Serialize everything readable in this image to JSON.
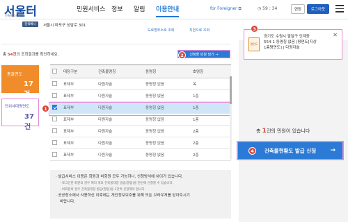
{
  "header": {
    "logo": "서울터",
    "logo_sub": "건축행정시스템",
    "nav": [
      "민원서비스",
      "정보",
      "알림",
      "이용안내"
    ],
    "foreigner_link": "for Foreigner",
    "timer": "59 : 34",
    "extend_label": "연장",
    "logout_label": "로그아웃"
  },
  "address": {
    "tag": "검색예시",
    "text": "서울시 마포구 성암로 301",
    "link1": "도로명주소로 조회",
    "link2": "지번으로 조회"
  },
  "summary": {
    "prefix": "총 ",
    "count": "54건",
    "suffix": "의 조회결과를 확인하세요."
  },
  "cards": {
    "general": {
      "label": "총괄면도",
      "count": "17건"
    },
    "unit": {
      "label": "단위세대평면도",
      "count": "37건"
    }
  },
  "request_button": "신청할 민원 담기 →",
  "table": {
    "headers": [
      "대장구분",
      "건축물명칭",
      "동명칭",
      "호명칭"
    ],
    "rows": [
      {
        "type": "표제부",
        "name": "다원자술",
        "dong": "동명칭 없음",
        "ho": "옥"
      },
      {
        "type": "표제부",
        "name": "다원자술",
        "dong": "동명칭 없음",
        "ho": "1층"
      },
      {
        "type": "표제부",
        "name": "다원자술",
        "dong": "동명칭 없음",
        "ho": "1층"
      },
      {
        "type": "표제부",
        "name": "다원자술",
        "dong": "동명칭 없음",
        "ho": "1층"
      },
      {
        "type": "표제부",
        "name": "다원자술",
        "dong": "동명칭 없음",
        "ho": "2층"
      },
      {
        "type": "표제부",
        "name": "다원자술",
        "dong": "동명칭 없음",
        "ho": "2층"
      },
      {
        "type": "표제부",
        "name": "다원자술",
        "dong": "동명칭 없음",
        "ho": "2층"
      }
    ]
  },
  "notice": {
    "line1": "· 발급서비스 이용은 회원과 비회원 모두 가능하나, 신청방식에 차이가 있습니다.",
    "line2": "- 로그인한 회원의 경우 여러 개의 건축물대장 발급(열람)을 한번에 신청할 수 있습니다.",
    "line3": "- 비회원의 경우 건축물대장 발급(열람)을 1건씩 신청해야 합니다.",
    "line4": "· 공공장소에서 사용하신 이후에는 개인정보보호를 위해 모든 브라우저를 닫아주시기",
    "line5": "바랍니다."
  },
  "popup": {
    "icon_label": "평면도",
    "line1": "경기도 수원시 팔달구 인계동",
    "line2": "554-1 동명칭 없음 |평면도[지상",
    "line3": "1층평면도] | 다원자술"
  },
  "right": {
    "count_prefix": "총 ",
    "count": "1",
    "count_suffix": "건의 민원이 있습니다",
    "issue_button": "건축물현황도 발급 신청",
    "arrow": "→"
  },
  "badges": [
    "1",
    "2",
    "3",
    "4"
  ],
  "colors": {
    "accent": "#2a7ad6",
    "highlight": "#e58ad8",
    "badge": "#d8463b",
    "orange": "#f08c2a"
  }
}
